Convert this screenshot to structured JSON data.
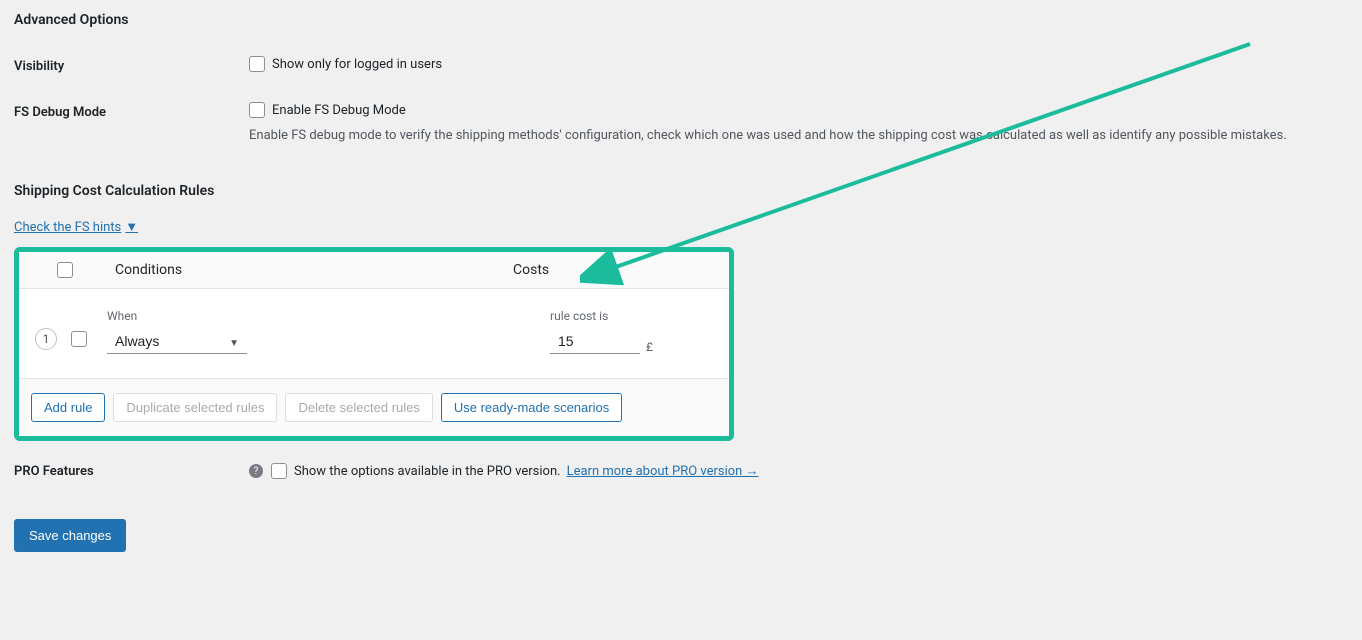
{
  "title": "Advanced Options",
  "visibility": {
    "label": "Visibility",
    "checkbox_label": "Show only for logged in users"
  },
  "debug": {
    "label": "FS Debug Mode",
    "checkbox_label": "Enable FS Debug Mode",
    "description": "Enable FS debug mode to verify the shipping methods' configuration, check which one was used and how the shipping cost was calculated as well as identify any possible mistakes."
  },
  "rules_title": "Shipping Cost Calculation Rules",
  "hints_link": "Check the FS hints",
  "table": {
    "conditions_header": "Conditions",
    "costs_header": "Costs",
    "rows": [
      {
        "num": "1",
        "when_label": "When",
        "when_value": "Always",
        "cost_label": "rule cost is",
        "cost_value": "15",
        "currency": "£"
      }
    ],
    "buttons": {
      "add": "Add rule",
      "duplicate": "Duplicate selected rules",
      "delete": "Delete selected rules",
      "scenarios": "Use ready-made scenarios"
    }
  },
  "pro": {
    "label": "PRO Features",
    "checkbox_label": "Show the options available in the PRO version.",
    "link": "Learn more about PRO version →"
  },
  "save_button": "Save changes"
}
